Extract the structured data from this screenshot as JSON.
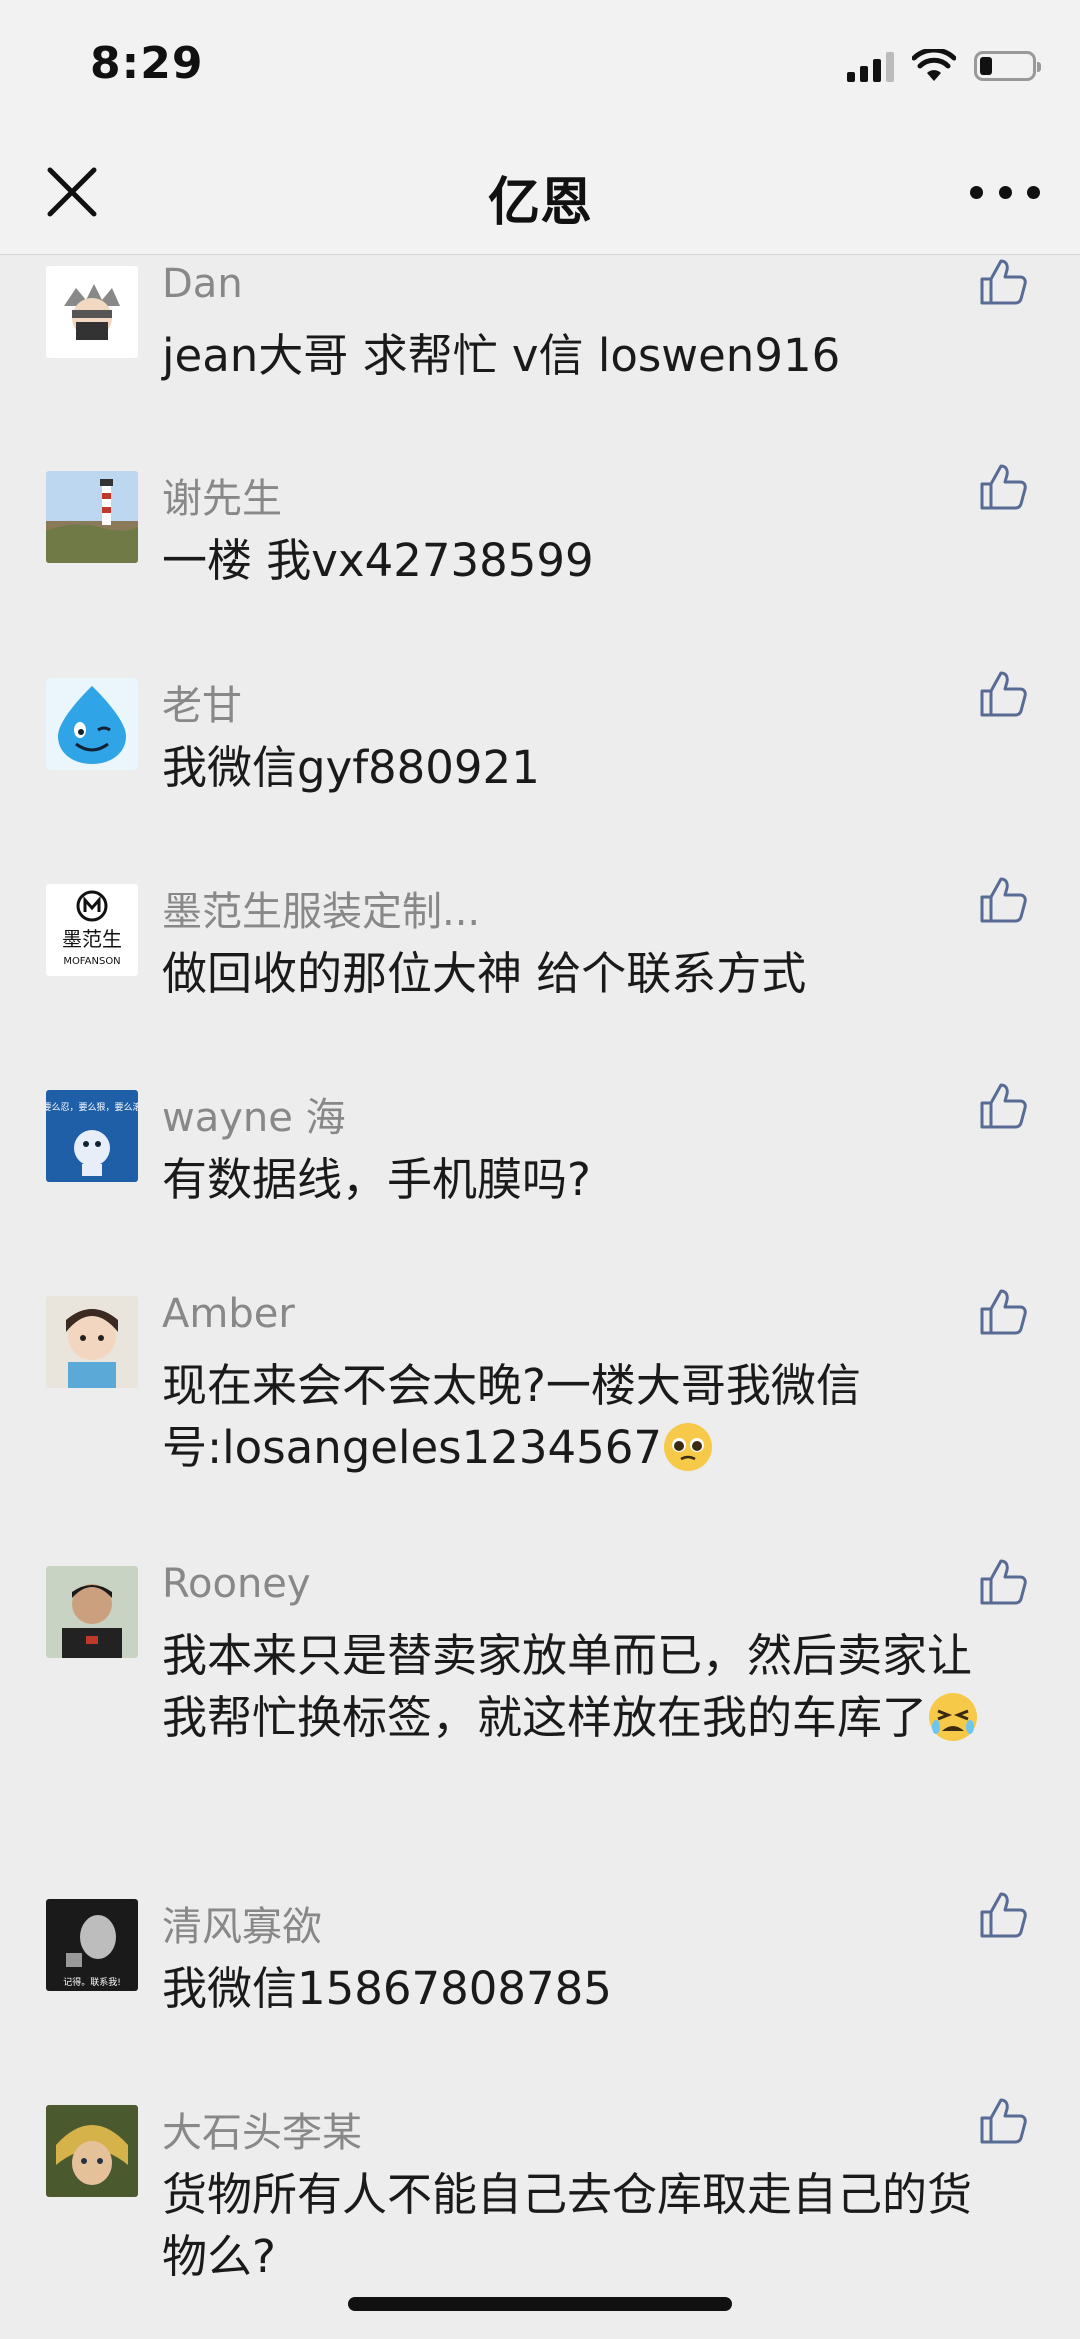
{
  "status_bar": {
    "time": "8:29"
  },
  "nav": {
    "title": "亿恩"
  },
  "comments": [
    {
      "name": "Dan",
      "text": "jean大哥 求帮忙 v信 loswen916"
    },
    {
      "name": "谢先生",
      "text": "一楼 我vx42738599"
    },
    {
      "name": "老甘",
      "text": "我微信gyf880921"
    },
    {
      "name": "墨范生服装定制...",
      "text": "做回收的那位大神 给个联系方式",
      "avatar_text": "墨范生",
      "avatar_sub": "MOFANSON"
    },
    {
      "name": "wayne 海",
      "text": "有数据线，手机膜吗?",
      "avatar_text": "要么忍，要么狠，要么滚"
    },
    {
      "name": "Amber",
      "text": "现在来会不会太晚?一楼大哥我微信号:losangeles1234567"
    },
    {
      "name": "Rooney",
      "text": "我本来只是替卖家放单而已，然后卖家让我帮忙换标签，就这样放在我的车库了"
    },
    {
      "name": "清风寡欲",
      "text": "我微信15867808785",
      "avatar_text": "记得。联系我!"
    },
    {
      "name": "大石头李某",
      "text": "货物所有人不能自己去仓库取走自己的货物么?"
    }
  ]
}
